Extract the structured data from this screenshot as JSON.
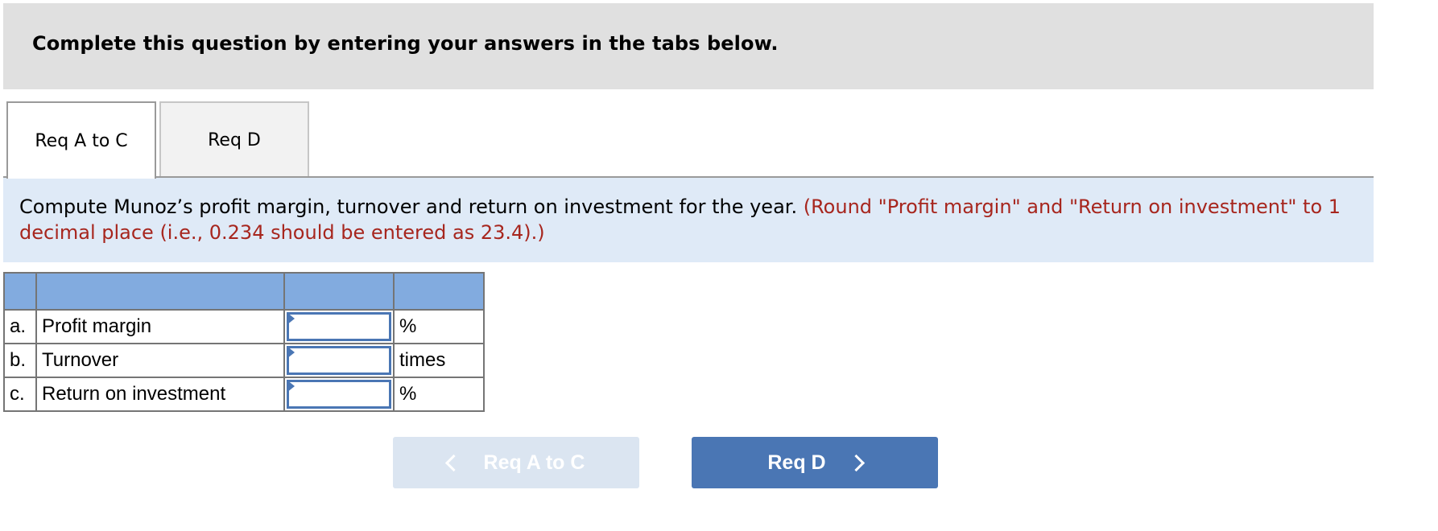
{
  "header": {
    "title": "Complete this question by entering your answers in the tabs below."
  },
  "tabs": [
    {
      "label": "Req A to C",
      "active": true
    },
    {
      "label": "Req D",
      "active": false
    }
  ],
  "instructions": {
    "text": "Compute Munoz’s profit margin, turnover and return on investment for the year.",
    "note": "(Round \"Profit margin\" and \"Return on investment\" to 1 decimal place (i.e., 0.234 should be entered as 23.4).)"
  },
  "table": {
    "headers": [
      "",
      "",
      "",
      ""
    ],
    "rows": [
      {
        "letter": "a.",
        "label": "Profit margin",
        "value": "",
        "unit": "%"
      },
      {
        "letter": "b.",
        "label": "Turnover",
        "value": "",
        "unit": "times"
      },
      {
        "letter": "c.",
        "label": "Return on investment",
        "value": "",
        "unit": "%"
      }
    ]
  },
  "navigation": {
    "prev_label": "Req A to C",
    "prev_icon": "chevron-left-icon",
    "prev_enabled": false,
    "next_label": "Req D",
    "next_icon": "chevron-right-icon"
  },
  "colors": {
    "accent": "#4a76b4",
    "table_header": "#82abdf",
    "instruction_bg": "#dfeaf7",
    "note_text": "#a7261e",
    "header_bg": "#e0e0e0"
  }
}
